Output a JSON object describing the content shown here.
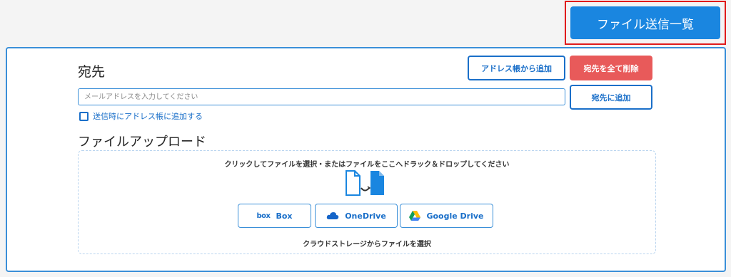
{
  "header": {
    "file_list_button": "ファイル送信一覧"
  },
  "recipient": {
    "title": "宛先",
    "add_from_address_book": "アドレス帳から追加",
    "delete_all": "宛先を全て削除",
    "email_placeholder": "メールアドレスを入力してください",
    "email_value": "",
    "add_recipient": "宛先に追加",
    "save_to_address_book": "送信時にアドレス帳に追加する"
  },
  "upload": {
    "title": "ファイルアップロード",
    "drop_hint": "クリックしてファイルを選択・またはファイルをここへドラック＆ドロップしてください",
    "cloud_buttons": [
      {
        "label": "Box",
        "icon": "box-logo-icon"
      },
      {
        "label": "OneDrive",
        "icon": "onedrive-cloud-icon"
      },
      {
        "label": "Google Drive",
        "icon": "google-drive-icon"
      }
    ],
    "box_logo_text": "box",
    "cloud_caption": "クラウドストレージからファイルを選択"
  },
  "colors": {
    "accent": "#1a86e0",
    "border_blue": "#3a8fd8",
    "danger": "#e85a5a",
    "highlight_outline": "#e01b1b"
  }
}
